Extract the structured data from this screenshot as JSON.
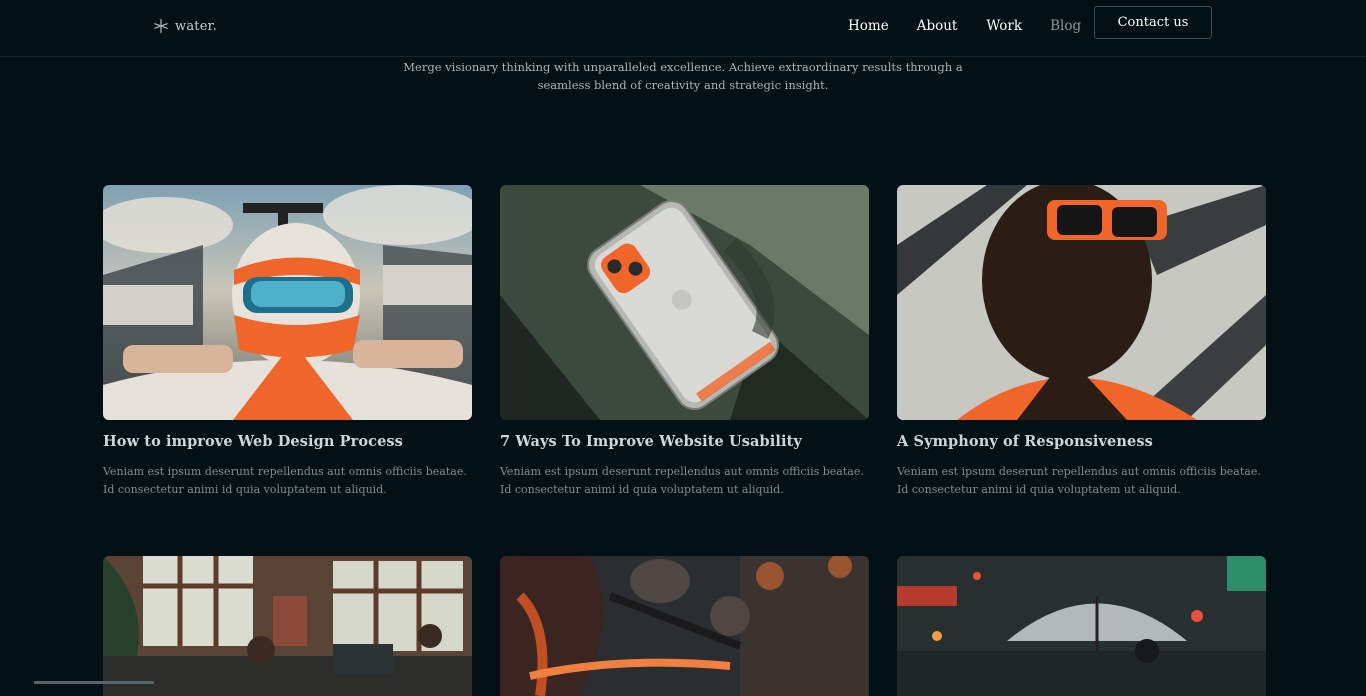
{
  "brand": {
    "name": "water.",
    "icon": "star-icon"
  },
  "nav": {
    "items": [
      {
        "label": "Home"
      },
      {
        "label": "About"
      },
      {
        "label": "Work"
      },
      {
        "label": "Blog"
      }
    ],
    "contact_label": "Contact us"
  },
  "intro": "Merge visionary thinking with unparalleled excellence. Achieve extraordinary results through a seamless blend of creativity and strategic insight.",
  "posts": [
    {
      "title": "How to improve Web Design Process",
      "excerpt": "Veniam est ipsum deserunt repellendus aut omnis officiis beatae. Id consectetur animi id quia voluptatem ut aliquid."
    },
    {
      "title": "7 Ways To Improve Website Usability",
      "excerpt": "Veniam est ipsum deserunt repellendus aut omnis officiis beatae. Id consectetur animi id quia voluptatem ut aliquid."
    },
    {
      "title": "A Symphony of Responsiveness",
      "excerpt": "Veniam est ipsum deserunt repellendus aut omnis officiis beatae. Id consectetur animi id quia voluptatem ut aliquid."
    }
  ],
  "colors": {
    "background": "#031116",
    "accent": "#f0652a"
  }
}
